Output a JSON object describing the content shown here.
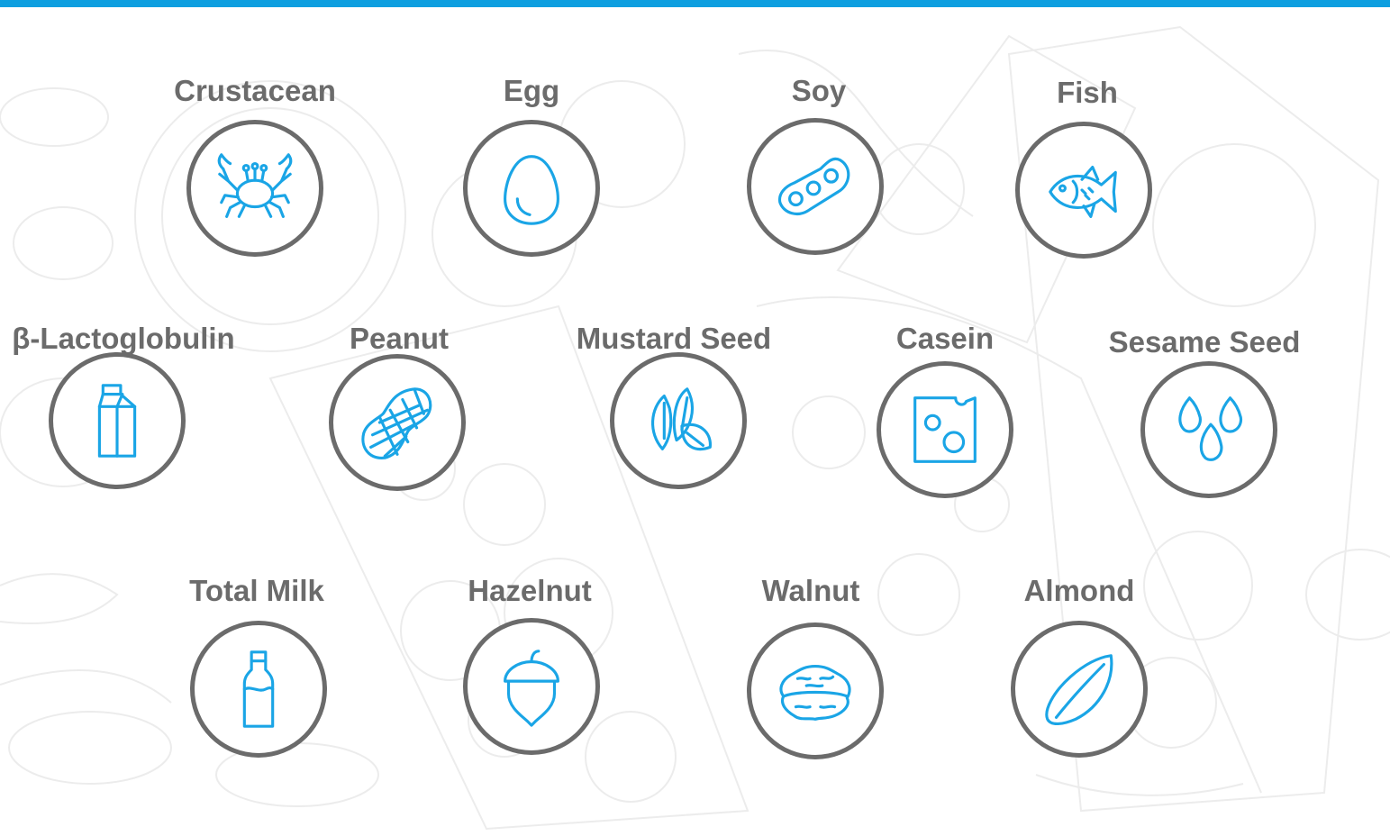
{
  "accent_color": "#1aa5e6",
  "ring_color": "#6b6b6b",
  "top_bar_color": "#0e9fe0",
  "allergens": [
    {
      "label": "Crustacean",
      "icon": "crab-icon"
    },
    {
      "label": "Egg",
      "icon": "egg-icon"
    },
    {
      "label": "Soy",
      "icon": "soybean-pod-icon"
    },
    {
      "label": "Fish",
      "icon": "fish-icon"
    },
    {
      "label": "β-Lactoglobulin",
      "icon": "milk-carton-icon"
    },
    {
      "label": "Peanut",
      "icon": "peanut-icon"
    },
    {
      "label": "Mustard Seed",
      "icon": "mustard-seed-icon"
    },
    {
      "label": "Casein",
      "icon": "cheese-icon"
    },
    {
      "label": "Sesame Seed",
      "icon": "sesame-seed-icon"
    },
    {
      "label": "Total Milk",
      "icon": "milk-bottle-icon"
    },
    {
      "label": "Hazelnut",
      "icon": "hazelnut-icon"
    },
    {
      "label": "Walnut",
      "icon": "walnut-icon"
    },
    {
      "label": "Almond",
      "icon": "almond-icon"
    }
  ]
}
